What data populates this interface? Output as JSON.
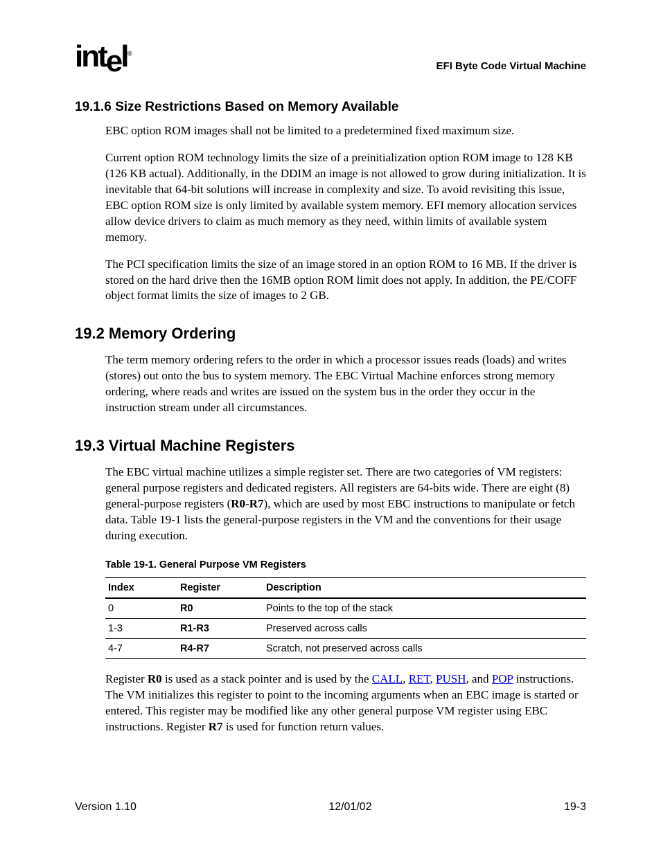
{
  "header": {
    "logo_text": "intel",
    "doc_title": "EFI Byte Code Virtual Machine"
  },
  "section_19_1_6": {
    "heading": "19.1.6   Size Restrictions Based on Memory Available",
    "p1": "EBC option ROM images shall not be limited to a predetermined fixed maximum size.",
    "p2": "Current option ROM technology limits the size of a preinitialization option ROM image to 128 KB (126 KB actual).  Additionally, in the DDIM an image is not allowed to grow during initialization.  It is inevitable that 64-bit solutions will increase in complexity and size.  To avoid revisiting this issue, EBC option ROM size is only limited by available system memory.  EFI memory allocation services allow device drivers to claim as much memory as they need, within limits of available system memory.",
    "p3": "The PCI specification limits the size of an image stored in an option ROM to 16 MB.  If the driver is stored on the hard drive then the 16MB option ROM limit does not apply.  In addition, the PE/COFF object format limits the size of images to 2 GB."
  },
  "section_19_2": {
    "heading": "19.2  Memory Ordering",
    "p1": "The term memory ordering refers to the order in which a processor issues reads (loads) and writes (stores) out onto the bus to system memory.  The EBC Virtual Machine enforces strong memory ordering, where reads and writes are issued on the system bus in the order they occur in the instruction stream under all circumstances."
  },
  "section_19_3": {
    "heading": "19.3  Virtual Machine Registers",
    "p1_pre": "The EBC virtual machine utilizes a simple register set. There are two categories of VM registers: general purpose registers and dedicated registers. All registers are 64-bits wide. There are eight (8) general-purpose registers (",
    "p1_bold1": "R0",
    "p1_dash": "-",
    "p1_bold2": "R7",
    "p1_post": "), which are used by most EBC instructions to manipulate or fetch data. Table 19-1 lists the general-purpose registers in the VM and the conventions for their usage during execution.",
    "table_caption": "Table 19-1.   General Purpose VM Registers",
    "table": {
      "headers": [
        "Index",
        "Register",
        "Description"
      ],
      "rows": [
        {
          "index": "0",
          "register": "R0",
          "desc": "Points to the top of the stack"
        },
        {
          "index": "1-3",
          "register": "R1-R3",
          "desc": "Preserved across calls"
        },
        {
          "index": "4-7",
          "register": "R4-R7",
          "desc": "Scratch, not preserved across calls"
        }
      ]
    },
    "p2": {
      "t1": "Register ",
      "b1": "R0",
      "t2": " is used as a stack pointer and is used by the ",
      "link1": "CALL",
      "t3": ", ",
      "link2": "RET",
      "t4": ", ",
      "link3": "PUSH",
      "t5": ", and ",
      "link4": "POP",
      "t6": " instructions. The VM initializes this register to point to the incoming arguments when an EBC image is started or entered. This register may be modified like any other general purpose VM register using EBC instructions. Register ",
      "b2": "R7",
      "t7": " is used for function return values."
    }
  },
  "footer": {
    "left": "Version 1.10",
    "center": "12/01/02",
    "right": "19-3"
  }
}
